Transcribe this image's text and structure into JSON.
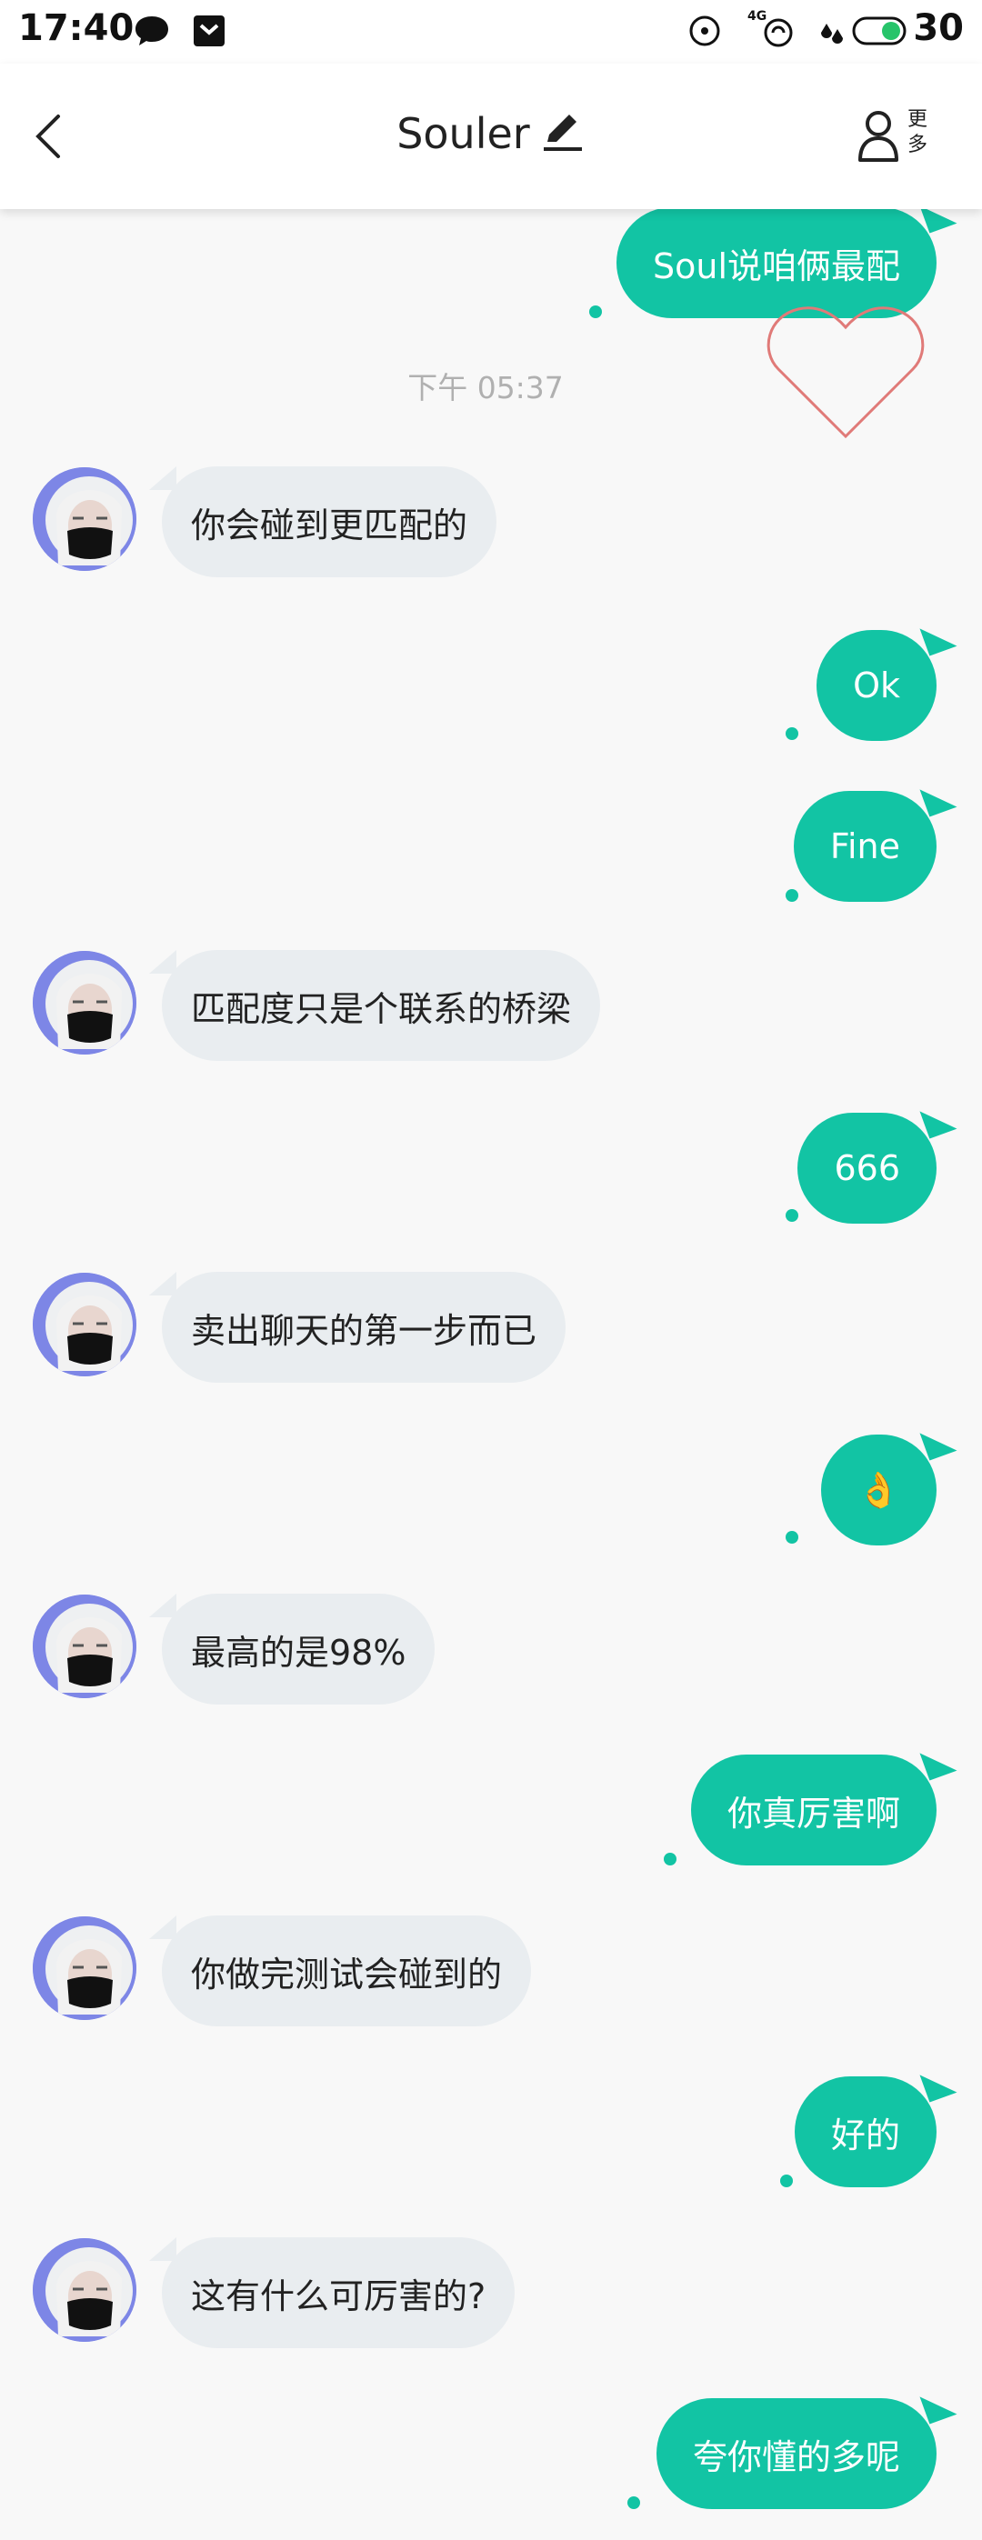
{
  "status_bar": {
    "time": "17:40",
    "battery_percent": "30",
    "network_label": "4G",
    "icons": [
      "chat-bubble-icon",
      "notification-box-icon",
      "target-icon",
      "network-4g-icon",
      "data-arrows-icon",
      "battery-icon"
    ]
  },
  "header": {
    "title": "Souler",
    "more_label_top": "更",
    "more_label_bottom": "多",
    "icons": [
      "back-chevron-icon",
      "edit-pencil-icon",
      "profile-icon"
    ]
  },
  "chat": {
    "timestamp": "下午 05:37",
    "messages": [
      {
        "side": "right",
        "text": "Soul说咱俩最配"
      },
      {
        "side": "left",
        "text": "你会碰到更匹配的"
      },
      {
        "side": "right",
        "text": "Ok"
      },
      {
        "side": "right",
        "text": "Fine"
      },
      {
        "side": "left",
        "text": "匹配度只是个联系的桥梁"
      },
      {
        "side": "right",
        "text": "666"
      },
      {
        "side": "left",
        "text": "卖出聊天的第一步而已"
      },
      {
        "side": "right",
        "text": "👌"
      },
      {
        "side": "left",
        "text": "最高的是98%"
      },
      {
        "side": "right",
        "text": "你真厉害啊"
      },
      {
        "side": "left",
        "text": "你做完测试会碰到的"
      },
      {
        "side": "right",
        "text": "好的"
      },
      {
        "side": "left",
        "text": "这有什么可厉害的?"
      },
      {
        "side": "right",
        "text": "夸你懂的多呢"
      }
    ]
  },
  "colors": {
    "accent": "#12c4a4",
    "incoming_bubble": "#e9edf0",
    "heart_stroke": "#e07a78",
    "avatar_ring": "#7d86e6"
  }
}
